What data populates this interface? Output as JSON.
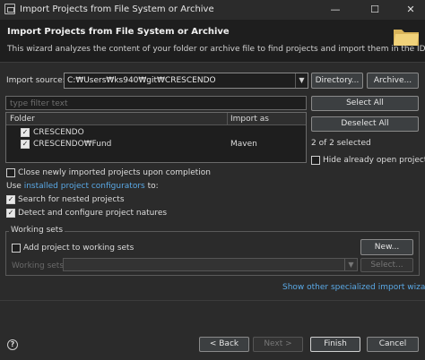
{
  "window": {
    "title": "Import Projects from File System or Archive",
    "minimize": "—",
    "maximize": "☐",
    "close": "✕"
  },
  "header": {
    "title": "Import Projects from File System or Archive",
    "description": "This wizard analyzes the content of your folder or archive file to find projects and import them in the IDE."
  },
  "import_source": {
    "label": "Import source:",
    "value": "C:₩Users₩ks940₩git₩CRESCENDO",
    "directory_button": "Directory...",
    "archive_button": "Archive..."
  },
  "filter": {
    "placeholder": "type filter text"
  },
  "table": {
    "columns": [
      "Folder",
      "Import as"
    ],
    "rows": [
      {
        "folder": "CRESCENDO",
        "import_as": "",
        "checked": true
      },
      {
        "folder": "CRESCENDO₩Fund",
        "import_as": "Maven",
        "checked": true
      }
    ]
  },
  "side": {
    "select_all": "Select All",
    "deselect_all": "Deselect All",
    "selected_count": "2 of 2 selected",
    "hide_open": "Hide already open projects"
  },
  "options": {
    "close_imported": "Close newly imported projects upon completion",
    "use_prefix": "Use ",
    "use_link": "installed project configurators",
    "use_suffix": " to:",
    "search_nested": "Search for nested projects",
    "detect_configure": "Detect and configure project natures"
  },
  "working_sets": {
    "group_label": "Working sets",
    "add_label": "Add project to working sets",
    "new_button": "New...",
    "sets_label": "Working sets:",
    "select_button": "Select..."
  },
  "show_other_link": "Show other specialized import wizards",
  "footer": {
    "help": "?",
    "back": "< Back",
    "next": "Next >",
    "finish": "Finish",
    "cancel": "Cancel"
  }
}
